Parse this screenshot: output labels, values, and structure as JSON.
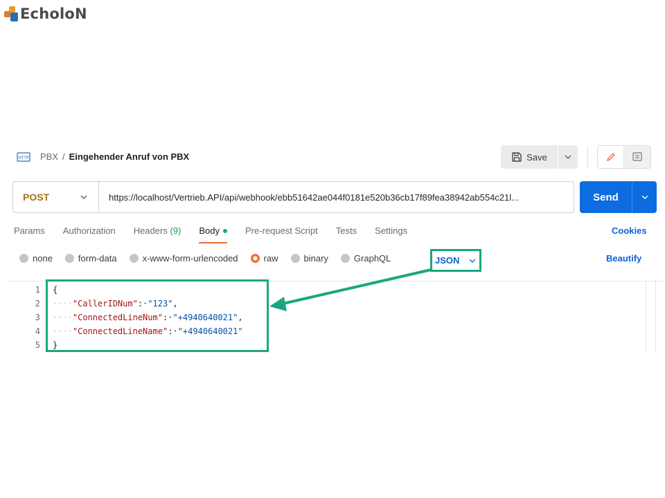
{
  "logo": {
    "text": "EcholoN"
  },
  "header": {
    "breadcrumb_parent": "PBX",
    "breadcrumb_separator": "/",
    "request_title": "Eingehender Anruf von PBX",
    "save_label": "Save"
  },
  "request": {
    "method": "POST",
    "url": "https://localhost/Vertrieb.API/api/webhook/ebb51642ae044f0181e520b36cb17f89fea38942ab554c21l...",
    "send_label": "Send"
  },
  "tabs": {
    "params": "Params",
    "authorization": "Authorization",
    "headers_label": "Headers",
    "headers_count": "(9)",
    "body": "Body",
    "pre_request": "Pre-request Script",
    "tests": "Tests",
    "settings": "Settings",
    "cookies": "Cookies"
  },
  "body_types": {
    "none": "none",
    "form_data": "form-data",
    "urlencoded": "x-www-form-urlencoded",
    "raw": "raw",
    "binary": "binary",
    "graphql": "GraphQL",
    "selected": "raw",
    "format": "JSON",
    "beautify": "Beautify"
  },
  "editor": {
    "line_numbers": [
      "1",
      "2",
      "3",
      "4",
      "5"
    ],
    "open_brace": "{",
    "close_brace": "}",
    "lines": [
      {
        "indent": "····",
        "key": "\"CallerIDNum\"",
        "colon": ":·",
        "value": "\"123\"",
        "comma": ","
      },
      {
        "indent": "····",
        "key": "\"ConnectedLineNum\"",
        "colon": ":·",
        "value": "\"+4940640021\"",
        "comma": ","
      },
      {
        "indent": "····",
        "key": "\"ConnectedLineName\"",
        "colon": ":·",
        "value": "\"+4940640021\"",
        "comma": ""
      }
    ]
  },
  "colors": {
    "accent_green": "#1aa77f",
    "send_blue": "#0c6ce0",
    "method_orange": "#a8740e",
    "active_tab": "#f26b3a"
  }
}
